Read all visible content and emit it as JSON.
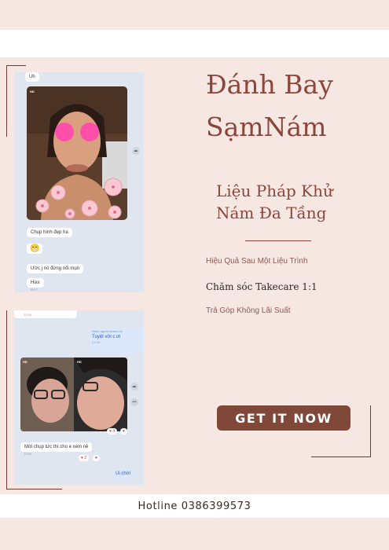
{
  "chat1": {
    "msg_top": "Uh",
    "hd": "HD",
    "msg1": "Chụp hình đẹp ha",
    "emoji": "😁",
    "msg2": "Ước j nó đừng nổi mụn",
    "msg3": "Hixx",
    "msg3_time": "16:07"
  },
  "chat2": {
    "time_top": "21:05",
    "quoted": "Nhấn người khách rồi",
    "reply": "Tuyệt vời c ơi",
    "reply_time": "21:05",
    "hd_left": "HD",
    "hd_right": "HD",
    "react1": "♥ 4",
    "react1_icon": "♥",
    "msg1": "Mới chụp tức thì cho e xem nè",
    "msg1_time": "21:06",
    "react2": "♥ 2",
    "react2_icon": "♥",
    "msg_me": "Ui chời"
  },
  "headline": {
    "line1": "Đánh Bay",
    "line2": "SạmNám"
  },
  "subtitle": {
    "line1": "Liệu Pháp Khử",
    "line2": "Nám Đa Tầng"
  },
  "features": [
    "Hiệu Quả Sau Một Liệu Trình",
    "Chăm sóc Takecare 1:1",
    "Trả Góp Không Lãi Suất"
  ],
  "cta_label": "GET IT NOW",
  "hotline": "Hotline 0386399573"
}
